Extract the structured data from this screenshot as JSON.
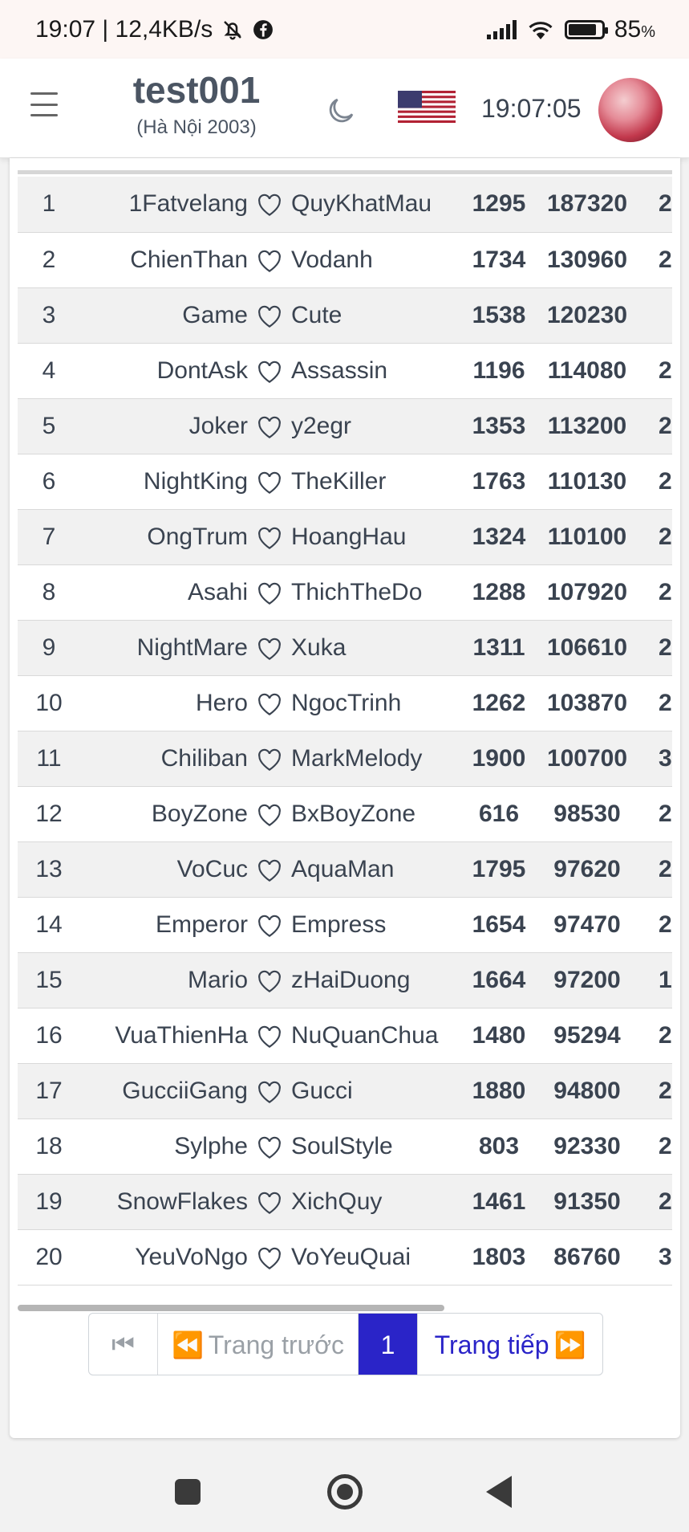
{
  "status_bar": {
    "text": "19:07 | 12,4KB/s",
    "battery": "85",
    "battery_unit": "%",
    "battery_level": 0.85
  },
  "header": {
    "title": "test001",
    "subtitle": "(Hà Nội 2003)",
    "clock": "19:07:05",
    "flag_icon": "us-flag-icon",
    "theme_icon": "moon-icon"
  },
  "table": {
    "rows": [
      {
        "rank": "1",
        "name1": "1Fatvelang",
        "name2": "QuyKhatMau",
        "val1": "1295",
        "val2": "187320",
        "val3": "2"
      },
      {
        "rank": "2",
        "name1": "ChienThan",
        "name2": "Vodanh",
        "val1": "1734",
        "val2": "130960",
        "val3": "2"
      },
      {
        "rank": "3",
        "name1": "Game",
        "name2": "Cute",
        "val1": "1538",
        "val2": "120230",
        "val3": ""
      },
      {
        "rank": "4",
        "name1": "DontAsk",
        "name2": "Assassin",
        "val1": "1196",
        "val2": "114080",
        "val3": "2"
      },
      {
        "rank": "5",
        "name1": "Joker",
        "name2": "y2egr",
        "val1": "1353",
        "val2": "113200",
        "val3": "2"
      },
      {
        "rank": "6",
        "name1": "NightKing",
        "name2": "TheKiller",
        "val1": "1763",
        "val2": "110130",
        "val3": "2"
      },
      {
        "rank": "7",
        "name1": "OngTrum",
        "name2": "HoangHau",
        "val1": "1324",
        "val2": "110100",
        "val3": "2"
      },
      {
        "rank": "8",
        "name1": "Asahi",
        "name2": "ThichTheDo",
        "val1": "1288",
        "val2": "107920",
        "val3": "2"
      },
      {
        "rank": "9",
        "name1": "NightMare",
        "name2": "Xuka",
        "val1": "1311",
        "val2": "106610",
        "val3": "2"
      },
      {
        "rank": "10",
        "name1": "Hero",
        "name2": "NgocTrinh",
        "val1": "1262",
        "val2": "103870",
        "val3": "2"
      },
      {
        "rank": "11",
        "name1": "Chiliban",
        "name2": "MarkMelody",
        "val1": "1900",
        "val2": "100700",
        "val3": "3"
      },
      {
        "rank": "12",
        "name1": "BoyZone",
        "name2": "BxBoyZone",
        "val1": "616",
        "val2": "98530",
        "val3": "2"
      },
      {
        "rank": "13",
        "name1": "VoCuc",
        "name2": "AquaMan",
        "val1": "1795",
        "val2": "97620",
        "val3": "2"
      },
      {
        "rank": "14",
        "name1": "Emperor",
        "name2": "Empress",
        "val1": "1654",
        "val2": "97470",
        "val3": "2"
      },
      {
        "rank": "15",
        "name1": "Mario",
        "name2": "zHaiDuong",
        "val1": "1664",
        "val2": "97200",
        "val3": "1"
      },
      {
        "rank": "16",
        "name1": "VuaThienHa",
        "name2": "NuQuanChua",
        "val1": "1480",
        "val2": "95294",
        "val3": "2"
      },
      {
        "rank": "17",
        "name1": "GucciiGang",
        "name2": "Gucci",
        "val1": "1880",
        "val2": "94800",
        "val3": "2"
      },
      {
        "rank": "18",
        "name1": "Sylphe",
        "name2": "SoulStyle",
        "val1": "803",
        "val2": "92330",
        "val3": "2"
      },
      {
        "rank": "19",
        "name1": "SnowFlakes",
        "name2": "XichQuy",
        "val1": "1461",
        "val2": "91350",
        "val3": "2"
      },
      {
        "rank": "20",
        "name1": "YeuVoNgo",
        "name2": "VoYeuQuai",
        "val1": "1803",
        "val2": "86760",
        "val3": "3"
      }
    ]
  },
  "pagination": {
    "first_icon": "⏮",
    "prev_label": "Trang trước",
    "prev_icon": "⏪",
    "current_page": "1",
    "next_label": "Trang tiếp",
    "next_icon": "⏩"
  },
  "colors": {
    "accent": "#2a24c8",
    "row_alt": "#f1f1f1",
    "text": "#3a4350"
  }
}
